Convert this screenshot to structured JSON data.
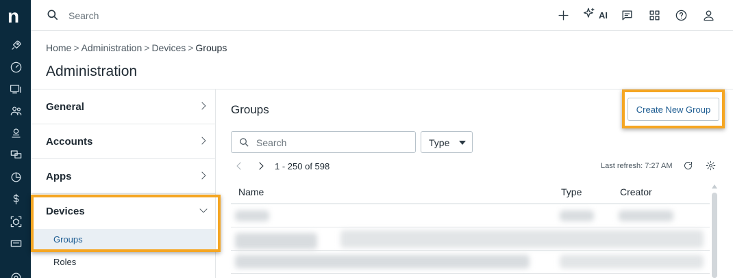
{
  "rail": {
    "logo": "n",
    "icons": [
      "rocket-icon",
      "gauge-icon",
      "devices-icon",
      "users-icon",
      "support-agent-icon",
      "screens-icon",
      "pie-chart-icon",
      "dollar-icon",
      "cube-scan-icon",
      "ticket-icon",
      "settings-icon"
    ]
  },
  "topbar": {
    "search_placeholder": "Search",
    "ai_label": "AI",
    "icons": [
      "plus-icon",
      "sparkle-icon",
      "chat-icon",
      "apps-grid-icon",
      "help-icon",
      "user-icon"
    ]
  },
  "breadcrumb": {
    "items": [
      "Home",
      "Administration",
      "Devices"
    ],
    "current": "Groups",
    "separator": ">"
  },
  "page_title": "Administration",
  "nav": {
    "items": [
      {
        "label": "General"
      },
      {
        "label": "Accounts"
      },
      {
        "label": "Apps"
      },
      {
        "label": "Devices",
        "expanded": true
      }
    ],
    "sub_items": [
      {
        "label": "Groups",
        "active": true
      },
      {
        "label": "Roles"
      }
    ]
  },
  "main": {
    "title": "Groups",
    "create_button": "Create New Group",
    "search_placeholder": "Search",
    "type_filter": "Type",
    "pager_text": "1 - 250 of 598",
    "last_refresh": "Last refresh: 7:27 AM",
    "columns": [
      "Name",
      "Type",
      "Creator"
    ]
  },
  "colors": {
    "rail_bg": "#0b2a3d",
    "highlight": "#f5a623",
    "accent": "#1e5d92"
  }
}
